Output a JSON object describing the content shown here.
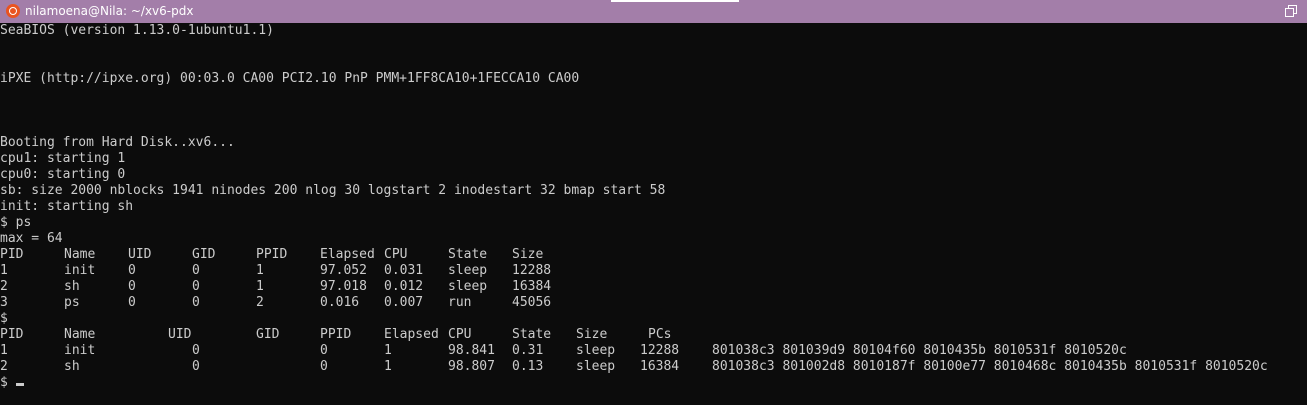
{
  "window": {
    "title": "nilamoena@Nila: ~/xv6-pdx"
  },
  "terminal": {
    "seabios": "SeaBIOS (version 1.13.0-1ubuntu1.1)",
    "ipxe": "iPXE (http://ipxe.org) 00:03.0 CA00 PCI2.10 PnP PMM+1FF8CA10+1FECCA10 CA00",
    "booting": "Booting from Hard Disk..xv6...",
    "cpu1": "cpu1: starting 1",
    "cpu0": "cpu0: starting 0",
    "sb": "sb: size 2000 nblocks 1941 ninodes 200 nlog 30 logstart 2 inodestart 32 bmap start 58",
    "init": "init: starting sh",
    "prompt_ps": "$ ps",
    "max": "max = 64",
    "ps_table": {
      "headers": [
        "PID",
        "Name",
        "UID",
        "GID",
        "PPID",
        "Elapsed",
        "CPU",
        "State",
        "Size"
      ],
      "rows": [
        [
          "1",
          "init",
          "0",
          "0",
          "1",
          "97.052",
          "0.031",
          "sleep",
          "12288"
        ],
        [
          "2",
          "sh",
          "0",
          "0",
          "1",
          "97.018",
          "0.012",
          "sleep",
          "16384"
        ],
        [
          "3",
          "ps",
          "0",
          "0",
          "2",
          "0.016",
          "0.007",
          "run",
          "45056"
        ]
      ]
    },
    "prompt_blank": "$",
    "procdump_table": {
      "headers": [
        "PID",
        "Name",
        "UID",
        "GID",
        "PPID",
        "Elapsed",
        "CPU",
        "State",
        "Size",
        "PCs"
      ],
      "rows": [
        [
          "1",
          "init",
          "0",
          "",
          "0",
          "1",
          "98.841",
          "0.31",
          "sleep",
          "12288",
          "801038c3 801039d9 80104f60 8010435b 8010531f 8010520c"
        ],
        [
          "2",
          "sh",
          "0",
          "",
          "0",
          "1",
          "98.807",
          "0.13",
          "sleep",
          "16384",
          "801038c3 801002d8 8010187f 80100e77 8010468c 8010435b 8010531f 8010520c"
        ]
      ]
    },
    "prompt_last": "$"
  }
}
